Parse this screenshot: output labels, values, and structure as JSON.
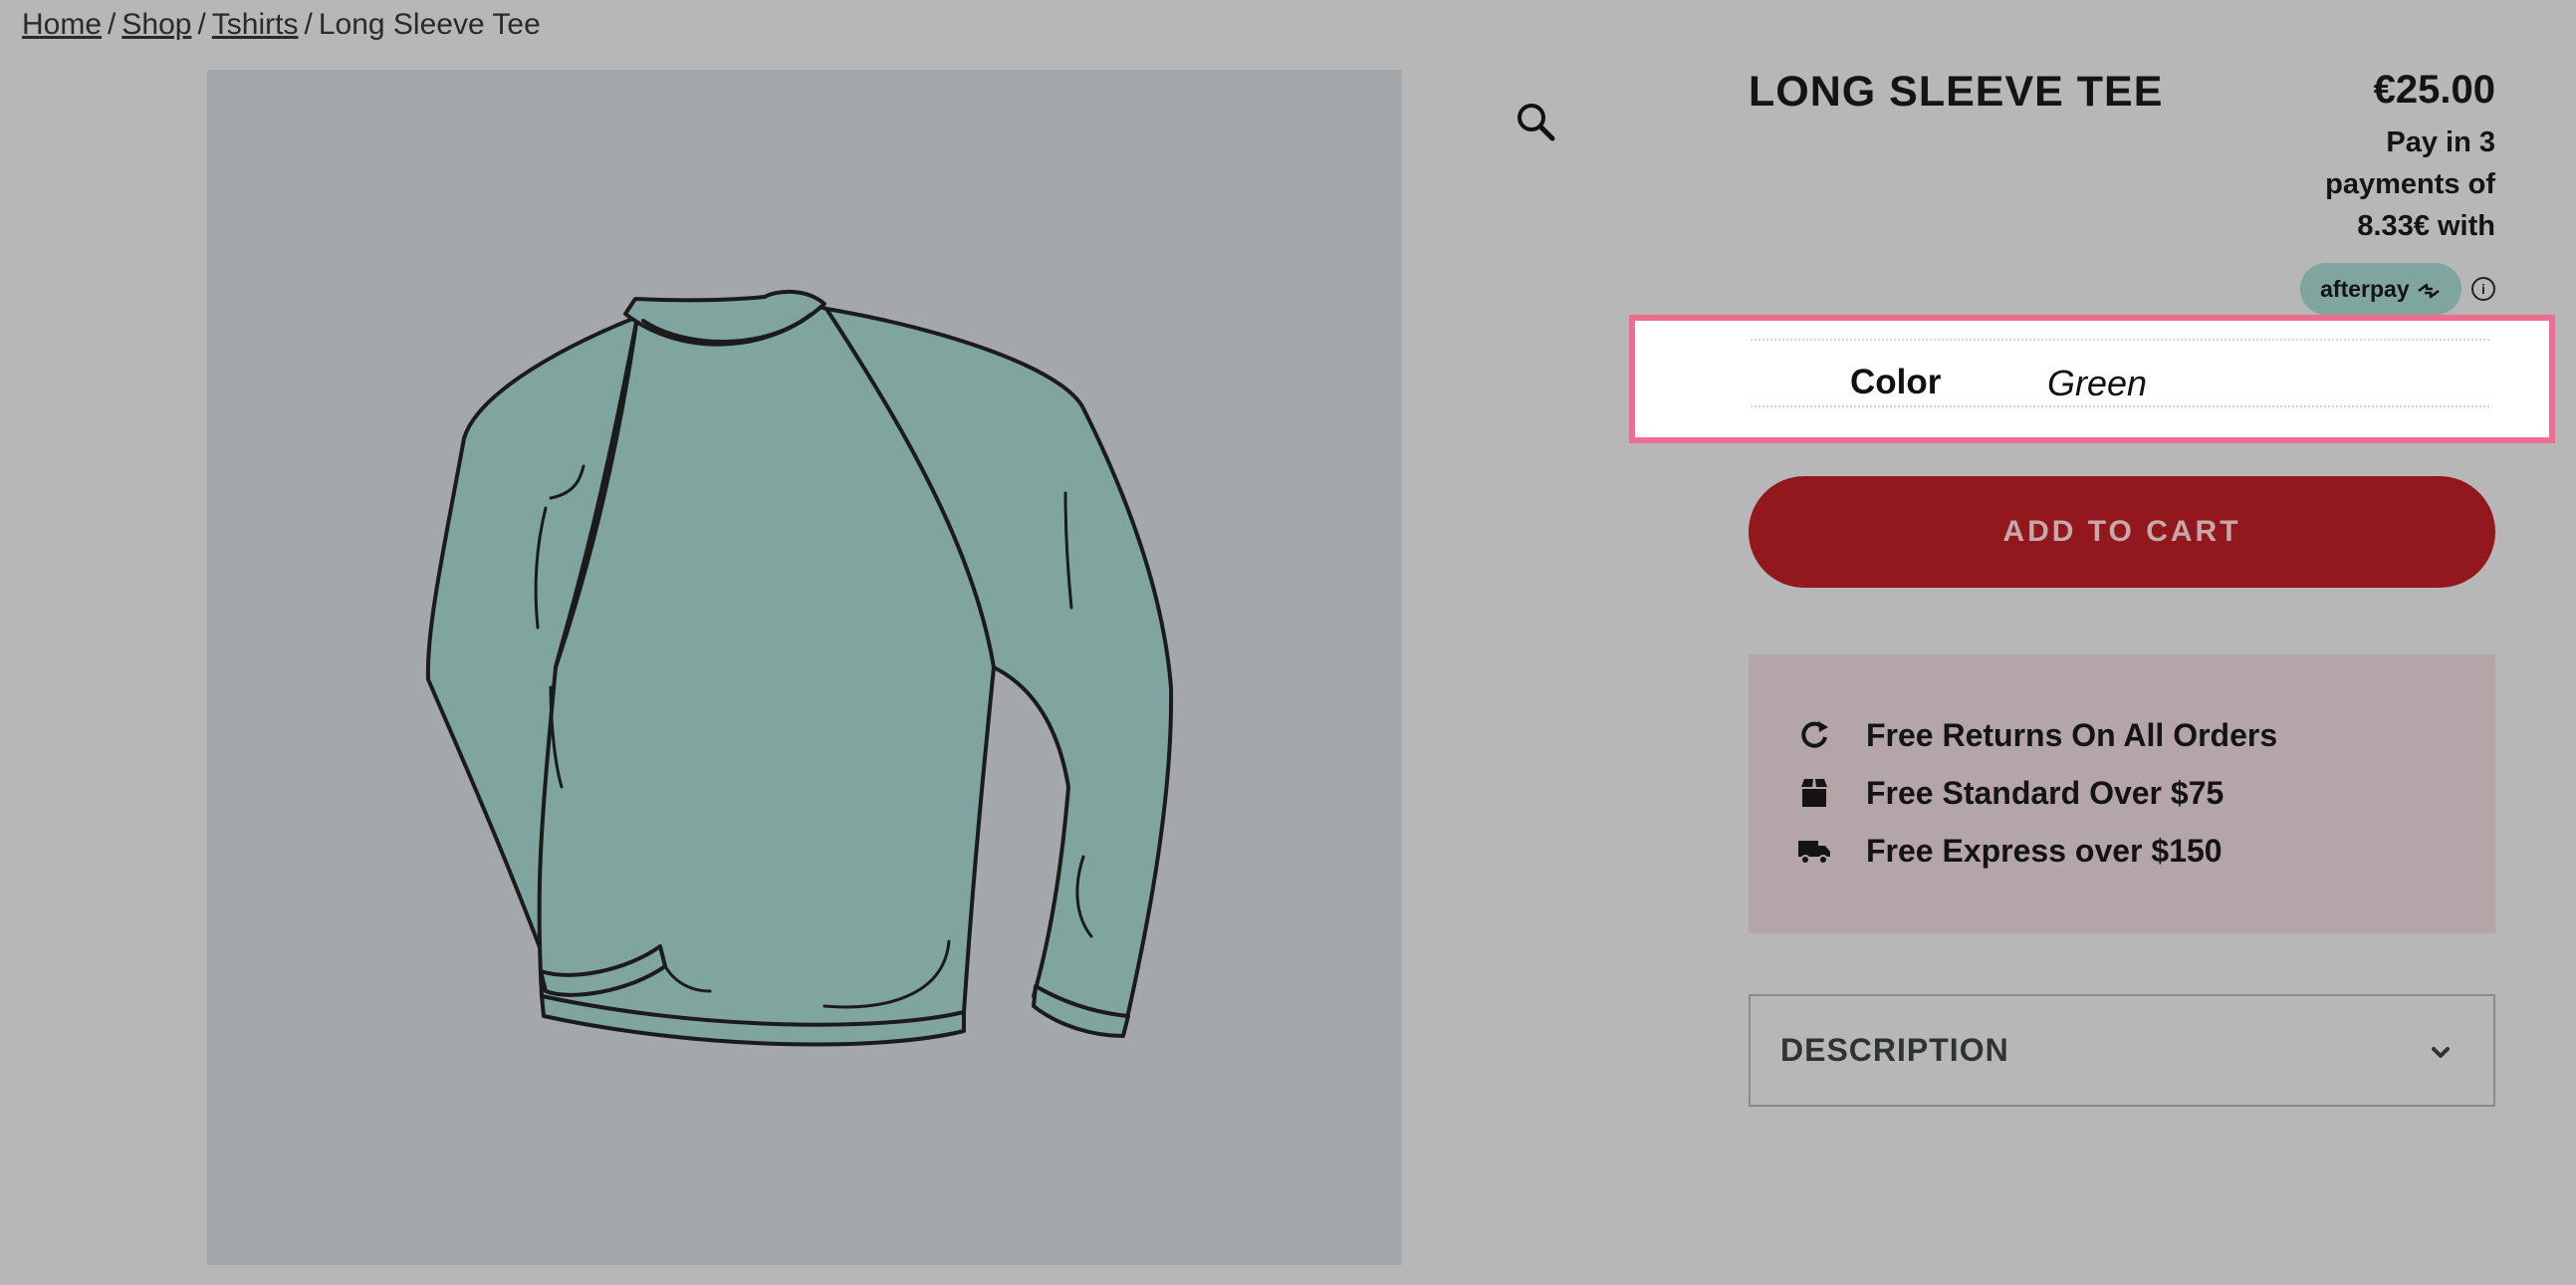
{
  "breadcrumb": {
    "home": "Home",
    "shop": "Shop",
    "category": "Tshirts",
    "current": "Long Sleeve Tee",
    "separator": "/"
  },
  "product": {
    "title": "LONG SLEEVE TEE",
    "price": "€25.00",
    "installment_text": "Pay in 3 payments of 8.33€ with",
    "afterpay_label": "afterpay",
    "info_icon": "info-icon",
    "zoom_icon": "search-icon"
  },
  "variation": {
    "label": "Color",
    "value": "Green"
  },
  "cart": {
    "button_label": "ADD TO CART"
  },
  "perks": [
    {
      "icon": "refresh-icon",
      "label": "Free Returns On All Orders"
    },
    {
      "icon": "box-icon",
      "label": "Free Standard Over $75"
    },
    {
      "icon": "truck-icon",
      "label": "Free Express over $150"
    }
  ],
  "description": {
    "label": "DESCRIPTION",
    "icon": "chevron-down-icon"
  },
  "colors": {
    "background": "#b7b7b7",
    "gallery_bg": "#a4a8ab",
    "shirt": "#7fa59e",
    "add_to_cart_bg": "#93181d",
    "perks_bg": "#b3a5a8",
    "highlight": "#ef6d93"
  }
}
